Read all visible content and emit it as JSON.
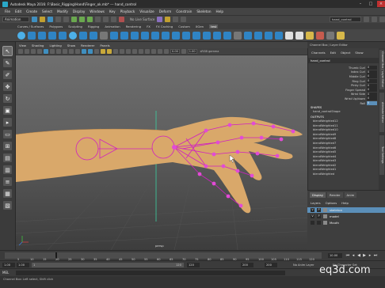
{
  "window": {
    "title": "Autodesk Maya 2016: F:\\Basic_Rigging\\Hand\\Finger_ok.mb* --- hand_control"
  },
  "menubar": [
    "File",
    "Edit",
    "Create",
    "Select",
    "Modify",
    "Display",
    "Windows",
    "Key",
    "Playback",
    "Visualize",
    "Deform",
    "Constrain",
    "Skeleton",
    "Help"
  ],
  "statusline": {
    "mode": "Animation",
    "live": "No Live Surface",
    "command_field": "hand_control"
  },
  "shelf_tabs": [
    "Curves / Surfaces",
    "Polygons",
    "Sculpting",
    "Rigging",
    "Animation",
    "Rendering",
    "FX",
    "FX Caching",
    "Custom",
    "XGen",
    "test"
  ],
  "shelf_active": "test",
  "viewport": {
    "menu": [
      "View",
      "Shading",
      "Lighting",
      "Show",
      "Renderer",
      "Panels"
    ],
    "field1": "0.00",
    "field2": "1.00",
    "colorspace": "sRGB gamma",
    "camera": "persp"
  },
  "channel_strip": "Channel Box / Layer Editor",
  "channel_box": {
    "menu": [
      "Channels",
      "Edit",
      "Object",
      "Show"
    ],
    "node": "hand_control",
    "attributes": [
      {
        "name": "Thumb Curl",
        "value": "0"
      },
      {
        "name": "Index Curl",
        "value": "0"
      },
      {
        "name": "Middle Curl",
        "value": "0"
      },
      {
        "name": "Ring Curl",
        "value": "0"
      },
      {
        "name": "Pinky Curl",
        "value": "0"
      },
      {
        "name": "Finger Spread",
        "value": "0"
      },
      {
        "name": "Wrist Side",
        "value": "0"
      },
      {
        "name": "Wrist Up/down",
        "value": "0"
      },
      {
        "name": "Roll",
        "value": "0"
      }
    ],
    "shapes_header": "SHAPES",
    "shapes": [
      "hand_controlShape"
    ],
    "outputs_header": "OUTPUTS",
    "outputs": [
      "blendWeighted12",
      "blendWeighted11",
      "blendWeighted10",
      "blendWeighted9",
      "blendWeighted8",
      "blendWeighted7",
      "blendWeighted6",
      "blendWeighted5",
      "blendWeighted4",
      "blendWeighted3",
      "blendWeighted2",
      "blendWeighted1",
      "blendWeighted"
    ]
  },
  "side_tabs": [
    "Channel Box / Layer Editor",
    "Attribute Editor",
    "Tool Settings"
  ],
  "layer_editor": {
    "tabs": [
      "Display",
      "Render",
      "Anim"
    ],
    "menu": [
      "Layers",
      "Options",
      "Help"
    ],
    "layers": [
      {
        "v": "V",
        "p": "P",
        "name": "skeleton",
        "selected": true,
        "swatch": "#8a8a8a"
      },
      {
        "v": "V",
        "p": "P",
        "name": "model",
        "selected": false,
        "swatch": "#8a8a8a"
      },
      {
        "v": "",
        "p": "",
        "name": "Mouth",
        "selected": false,
        "swatch": "#8a8a8a"
      }
    ]
  },
  "timeslider": {
    "ticks": [
      "5",
      "10",
      "15",
      "20",
      "25",
      "30",
      "35",
      "40",
      "45",
      "50",
      "55",
      "60",
      "65",
      "70",
      "75",
      "80",
      "85",
      "90",
      "95",
      "100",
      "105",
      "110",
      "115",
      "120"
    ],
    "current_frame": "10.00"
  },
  "range": {
    "start": "1.00",
    "inner_start": "1.00",
    "slider_start": "1",
    "slider_end": "120",
    "inner_end": "120",
    "end": "200",
    "end2": "200",
    "anim_layer": "No Anim Layer",
    "char_set": "No Character Set"
  },
  "cmdline": {
    "label": "MEL"
  },
  "helpline": {
    "text": "Channel Box: Left select, Shift click"
  },
  "watermark": "eq3d.com",
  "colors": {
    "rig_magenta": "#d020c0",
    "skin": "#d9a86a",
    "selection_blue": "#5b8fb9"
  }
}
